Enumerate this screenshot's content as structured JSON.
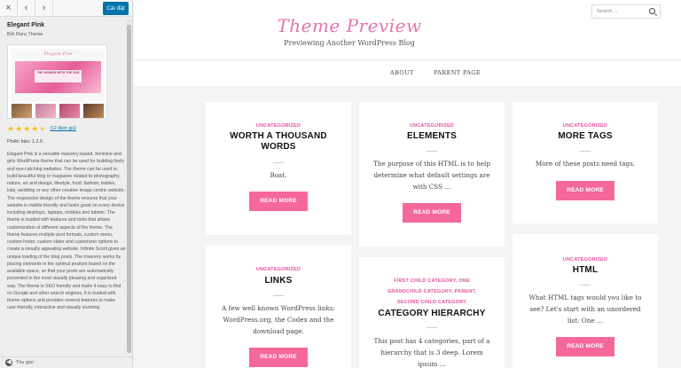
{
  "sidebar": {
    "close_icon": "×",
    "prev_icon": "‹",
    "next_icon": "›",
    "install_label": "Cài đặt",
    "theme_name": "Elegant Pink",
    "theme_author": "Bởi Rara Theme",
    "screenshot": {
      "logo_text": "Elegant Pink",
      "banner_text_line1": "THE WOMEN WITH THE SUN",
      "banner_text_line2": "GLASS"
    },
    "rating_stars": "★★★★★",
    "rating_value": 4.5,
    "rating_count": "(12 đánh giá)",
    "version_text": "Phiên bản: 1.2.6",
    "description": "Elegant Pink is a versatile masonry based, feminine and girly WordPress theme that can be used for building lively and eye-catching websites. The theme can be used to build beautiful blog or magazine related to photography, nature, art and design, lifestyle, food, fashion, babies, kids, wedding or any other creative image centric website. The responsive design of the theme ensures that your website is mobile friendly and looks great on every device including desktops, laptops, mobiles and tablets. The theme is loaded with features and tools that allows customization of different aspects of the theme. The theme features multiple post formats, custom menu, custom footer, custom slider and customizer options to create a visually appealing website. Infinite Scroll gives an unique loading of the blog posts. The masonry works by placing elements in the optimal position based on the available space, so that your posts are automatically presented in the most visually pleasing and organized way. The theme is SEO friendly and make it easy to find on Google and other search engines. It is loaded with theme options and provides several features to make user-friendly, interactive and visually stunning",
    "collapse_label": "Thu gọn",
    "collapse_icon": "◀"
  },
  "preview": {
    "search_placeholder": "Search ...",
    "site_title": "Theme Preview",
    "site_description": "Previewing Another WordPress Blog",
    "nav": [
      "ABOUT",
      "PARENT PAGE"
    ],
    "read_more_label": "READ MORE",
    "posts": [
      {
        "category": "UNCATEGORIZED",
        "title_lines": [
          "WORTH A THOUSAND",
          "WORDS"
        ],
        "excerpt_lines": [
          "Boat."
        ]
      },
      {
        "category": "UNCATEGORIZED",
        "title_lines": [
          "ELEMENTS"
        ],
        "excerpt_lines": [
          "The purpose of this HTML is to help",
          "determine what default settings are",
          "with CSS …"
        ]
      },
      {
        "category": "UNCATEGORIZED",
        "title_lines": [
          "MORE TAGS"
        ],
        "excerpt_lines": [
          "More of these posts need tags."
        ]
      },
      {
        "category": "UNCATEGORIZED",
        "title_lines": [
          "LINKS"
        ],
        "excerpt_lines": [
          "A few well known WordPress links:",
          "WordPress.org, the Codex and the",
          "download page."
        ]
      },
      {
        "category_lines": [
          "FIRST CHILD CATEGORY, ONE",
          "GRANDCHILD CATEGORY, PARENT,",
          "SECOND CHILD CATEGORY"
        ],
        "title_lines": [
          "CATEGORY HIERARCHY"
        ],
        "excerpt_lines": [
          "This post has 4 categories, part of a",
          "hierarchy that is 3 deep. Lorem",
          "ipsum …"
        ]
      },
      {
        "category": "UNCATEGORIZED",
        "title_lines": [
          "HTML"
        ],
        "excerpt_lines": [
          "What HTML tags would you like to",
          "see? Let's start with an unordered",
          "list: One …"
        ]
      }
    ]
  },
  "colors": {
    "accent_pink": "#e573b0",
    "button_pink": "#f5689b",
    "category_pink": "#e5509f",
    "install_blue": "#0073aa"
  }
}
